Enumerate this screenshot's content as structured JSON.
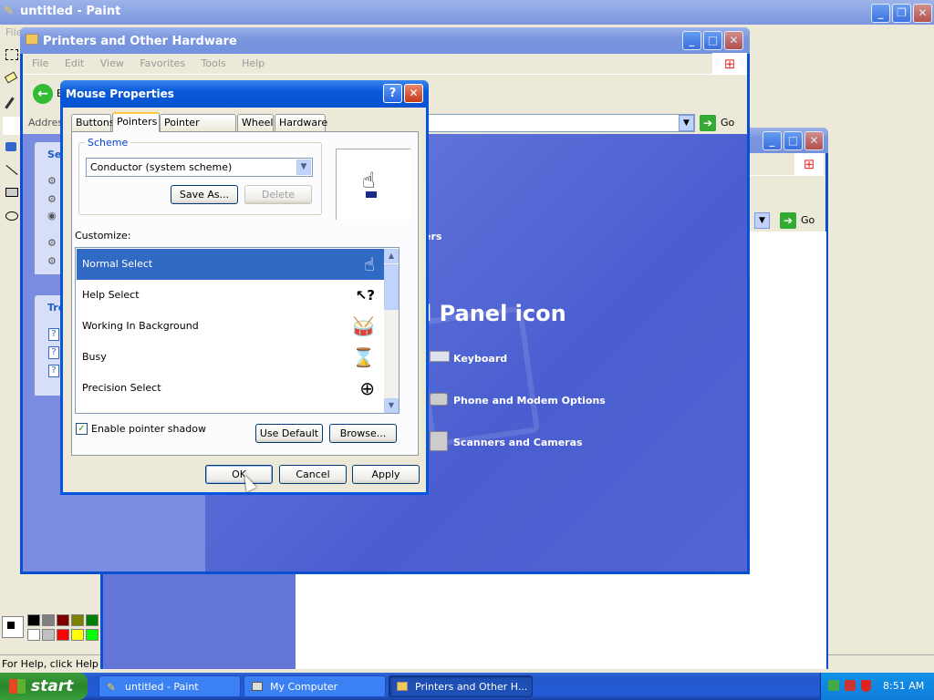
{
  "paint": {
    "title": "untitled - Paint",
    "menu_partial": "File",
    "status": "For Help, click Help Top",
    "palette": [
      "#000000",
      "#808080",
      "#800000",
      "#808000",
      "#008000",
      "#ffffff",
      "#c0c0c0",
      "#ff0000",
      "#ffff00",
      "#00ff00"
    ]
  },
  "printers": {
    "title": "Printers and Other Hardware",
    "menu": [
      "File",
      "Edit",
      "View",
      "Favorites",
      "Tools",
      "Help"
    ],
    "address_label": "Address",
    "go_label": "Go",
    "back_partial": "B",
    "panel1_partial": "Se",
    "panel2_partial": "Tro",
    "link_partial": "ers",
    "heading_partial": "l Panel icon",
    "items": [
      {
        "label": "Keyboard",
        "icon": "keyboard-icon"
      },
      {
        "label": "Phone and Modem Options",
        "icon": "phone-icon"
      },
      {
        "label": "Scanners and Cameras",
        "icon": "scanner-icon"
      }
    ]
  },
  "mycomputer": {
    "go_label": "Go"
  },
  "dialog": {
    "title": "Mouse Properties",
    "tabs": [
      "Buttons",
      "Pointers",
      "Pointer Options",
      "Wheel",
      "Hardware"
    ],
    "scheme_legend": "Scheme",
    "scheme_value": "Conductor (system scheme)",
    "save_as": "Save As...",
    "delete": "Delete",
    "customize_label": "Customize:",
    "cursors": [
      {
        "label": "Normal Select",
        "icon": "☝"
      },
      {
        "label": "Help Select",
        "icon": "↖?"
      },
      {
        "label": "Working In Background",
        "icon": "🥁"
      },
      {
        "label": "Busy",
        "icon": "⌛"
      },
      {
        "label": "Precision Select",
        "icon": "⊕"
      }
    ],
    "shadow_label": "Enable pointer shadow",
    "use_default": "Use Default",
    "browse": "Browse...",
    "ok": "OK",
    "cancel": "Cancel",
    "apply": "Apply"
  },
  "taskbar": {
    "start": "start",
    "tasks": [
      "untitled - Paint",
      "My Computer",
      "Printers and Other H..."
    ],
    "clock": "8:51 AM"
  }
}
